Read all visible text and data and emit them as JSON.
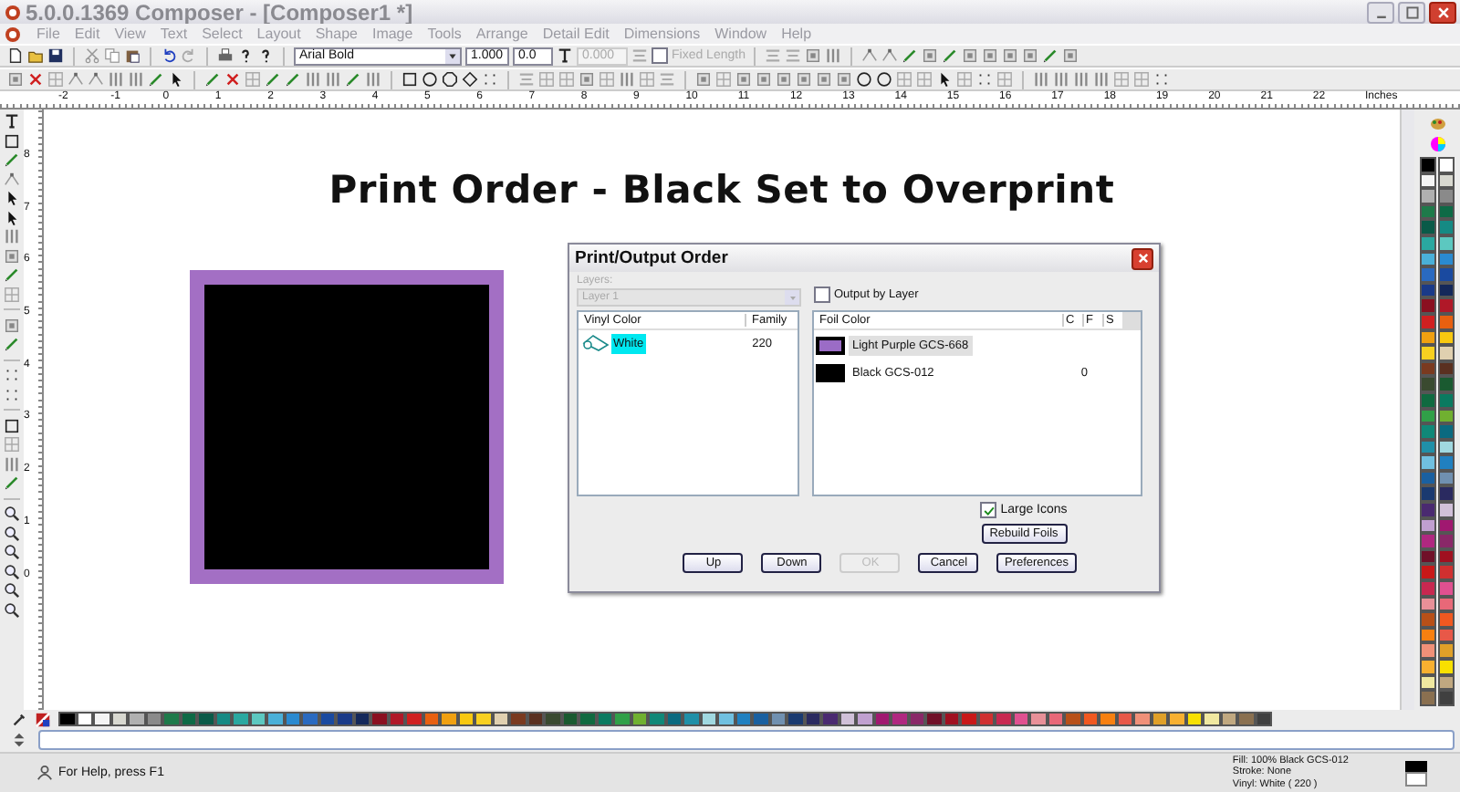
{
  "window": {
    "title": "5.0.0.1369 Composer - [Composer1 *]"
  },
  "menu": [
    "File",
    "Edit",
    "View",
    "Text",
    "Select",
    "Layout",
    "Shape",
    "Image",
    "Tools",
    "Arrange",
    "Detail Edit",
    "Dimensions",
    "Window",
    "Help"
  ],
  "toolbar": {
    "font": "Arial Bold",
    "size": "1.000",
    "spacing": "0.0",
    "length": {
      "value": "0.000",
      "disabled": true
    },
    "fixed_length": {
      "label": "Fixed Length",
      "checked": false,
      "disabled": true
    }
  },
  "ruler": {
    "marks": [
      "-2",
      "-1",
      "0",
      "1",
      "2",
      "3",
      "4",
      "5",
      "6",
      "7",
      "8",
      "9",
      "10",
      "11",
      "12",
      "13",
      "14",
      "15",
      "16",
      "17",
      "18",
      "19",
      "20",
      "21",
      "22"
    ],
    "unit": "Inches"
  },
  "vertical_ruler": {
    "marks": [
      "8",
      "7",
      "6",
      "5",
      "4",
      "3",
      "2",
      "1",
      "0"
    ]
  },
  "canvas": {
    "heading": "Print Order - Black Set to Overprint"
  },
  "dialog": {
    "title": "Print/Output Order",
    "layers_label": "Layers:",
    "layer": {
      "value": "Layer 1",
      "disabled": true
    },
    "output_by_layer": {
      "label": "Output by Layer",
      "checked": false
    },
    "vinyl_columns": [
      "Vinyl Color",
      "Family"
    ],
    "vinyl_rows": [
      {
        "name": "White",
        "family": "220",
        "selected": true
      }
    ],
    "foil_columns": [
      "Foil Color",
      "C",
      "F",
      "S"
    ],
    "foil_rows": [
      {
        "name": "Light Purple GCS-668",
        "color": "#9b6cc6",
        "selected": true
      },
      {
        "name": "Black GCS-012",
        "color": "#000000",
        "c": "0",
        "selected": false
      }
    ],
    "large_icons": {
      "label": "Large Icons",
      "checked": true
    },
    "rebuild": "Rebuild Foils",
    "buttons": [
      {
        "label": "Up",
        "disabled": false
      },
      {
        "label": "Down",
        "disabled": false
      },
      {
        "label": "OK",
        "disabled": true
      },
      {
        "label": "Cancel",
        "disabled": false
      },
      {
        "label": "Preferences",
        "disabled": false
      }
    ]
  },
  "palette": [
    {
      "color": "#000000"
    },
    {
      "color": "#ffffff"
    },
    {
      "color": "#f4f4f4"
    },
    {
      "color": "#d8d8d0"
    },
    {
      "color": "#b0b0b0"
    },
    {
      "color": "#8a8a8a"
    },
    {
      "color": "#1e7a4a"
    },
    {
      "color": "#0e6a46"
    },
    {
      "color": "#0a5a48"
    },
    {
      "color": "#158a84"
    },
    {
      "color": "#2aa8a0"
    },
    {
      "color": "#5cc8c0"
    },
    {
      "color": "#4ab0d8"
    },
    {
      "color": "#2a8ad0"
    },
    {
      "color": "#2a6ac0"
    },
    {
      "color": "#1a4aa0"
    },
    {
      "color": "#1a3a88"
    },
    {
      "color": "#14285a"
    },
    {
      "color": "#8a1020"
    },
    {
      "color": "#b01828"
    },
    {
      "color": "#d02020"
    },
    {
      "color": "#e86010"
    },
    {
      "color": "#f0a010"
    },
    {
      "color": "#f8c810"
    },
    {
      "color": "#f8d020"
    },
    {
      "color": "#e0d0b0"
    },
    {
      "color": "#7a3a20"
    },
    {
      "color": "#5a3020"
    },
    {
      "color": "#3a4a30"
    },
    {
      "color": "#1a5a30"
    },
    {
      "color": "#106a40"
    },
    {
      "color": "#0a7a60"
    },
    {
      "color": "#30a048"
    },
    {
      "color": "#70b030"
    },
    {
      "color": "#108878"
    },
    {
      "color": "#0a6a80"
    },
    {
      "color": "#2090a8"
    },
    {
      "color": "#a0d8e0"
    },
    {
      "color": "#70c0e0"
    },
    {
      "color": "#2080c0"
    },
    {
      "color": "#1a60a0"
    },
    {
      "color": "#7090b0"
    },
    {
      "color": "#1a3a70"
    },
    {
      "color": "#2a2a60"
    },
    {
      "color": "#4a2a70"
    },
    {
      "color": "#d0c0d8"
    },
    {
      "color": "#c0a0d0"
    },
    {
      "color": "#a01870"
    },
    {
      "color": "#b02880"
    },
    {
      "color": "#8a2868"
    },
    {
      "color": "#701028"
    },
    {
      "color": "#a01020"
    },
    {
      "color": "#c81818"
    },
    {
      "color": "#d03030"
    },
    {
      "color": "#c82850"
    },
    {
      "color": "#e05090"
    },
    {
      "color": "#e89098"
    },
    {
      "color": "#e86878"
    },
    {
      "color": "#b85018"
    },
    {
      "color": "#f05820"
    },
    {
      "color": "#f88010"
    },
    {
      "color": "#e85848"
    },
    {
      "color": "#f09078"
    },
    {
      "color": "#e0a028"
    },
    {
      "color": "#f8b030"
    },
    {
      "color": "#f8e000"
    },
    {
      "color": "#f0e8a0"
    },
    {
      "color": "#c0a880"
    },
    {
      "color": "#8a7050"
    },
    {
      "color": "#404040"
    }
  ],
  "status_bar": {
    "help": "For Help, press F1",
    "fill": "Fill: 100% Black GCS-012",
    "stroke": "Stroke: None",
    "vinyl": "Vinyl: White ( 220 )"
  }
}
